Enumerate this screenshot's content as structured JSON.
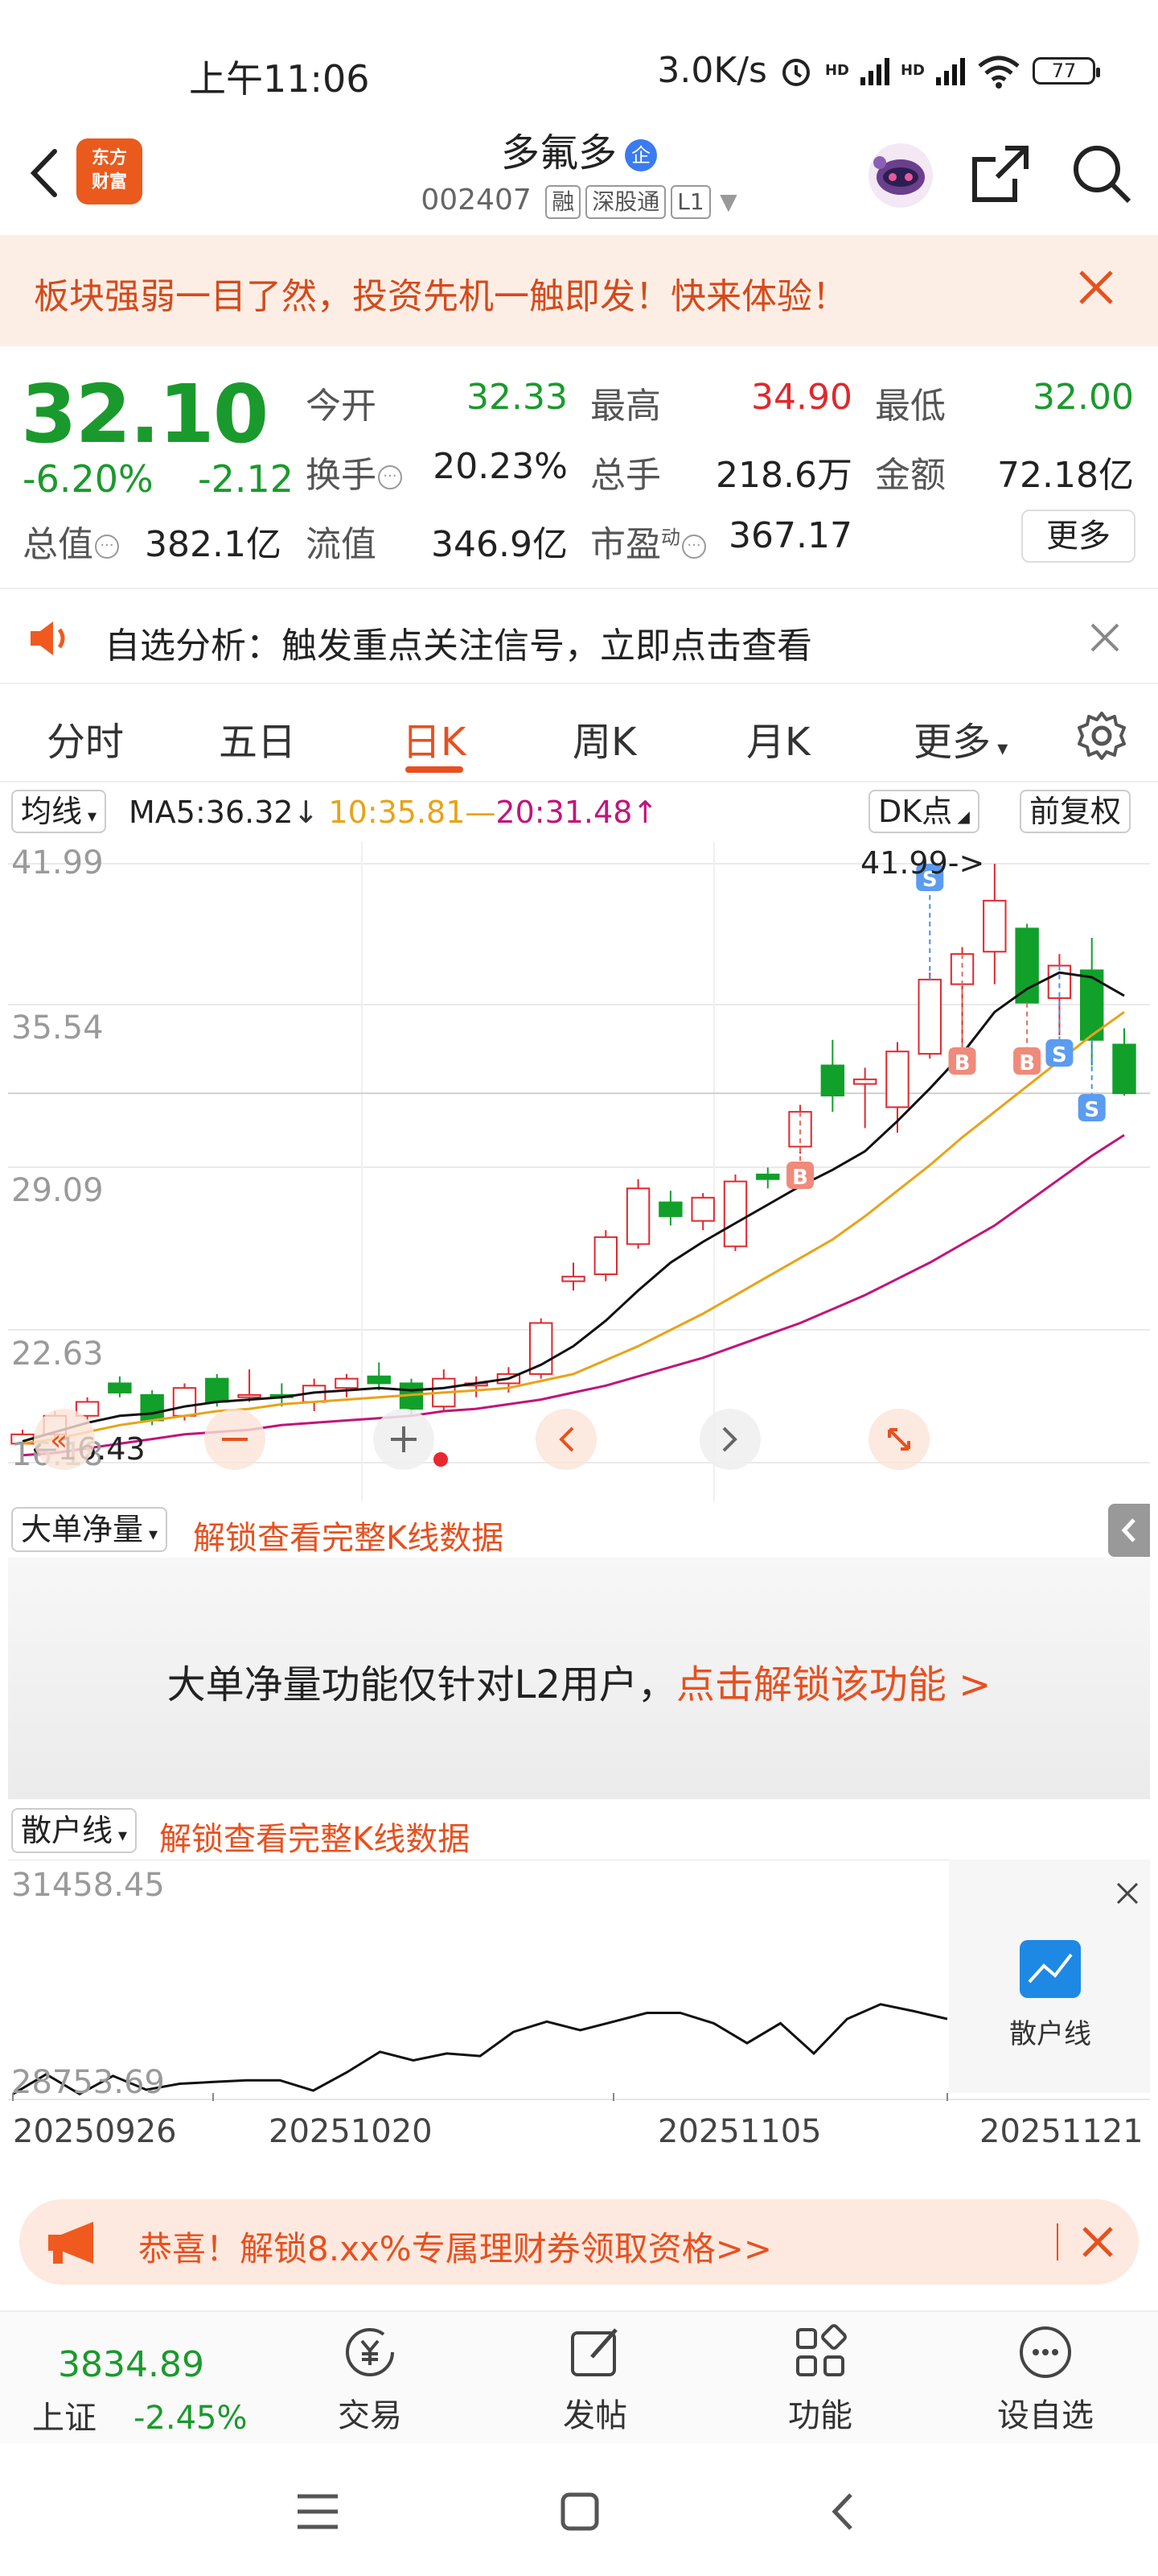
{
  "status": {
    "time": "上午11:06",
    "net_speed": "3.0K/s",
    "hd1": "HD",
    "hd2": "HD",
    "battery": "77"
  },
  "header": {
    "logo": "东方财富",
    "name": "多氟多",
    "corp_badge": "企",
    "code": "002407",
    "tags": [
      "融",
      "深股通",
      "L1"
    ]
  },
  "banner": {
    "text": "板块强弱一目了然，投资先机一触即发！快来体验！"
  },
  "quote": {
    "price": "32.10",
    "change_pct": "-6.20%",
    "change": "-2.12",
    "open_label": "今开",
    "open": "32.33",
    "high_label": "最高",
    "high": "34.90",
    "low_label": "最低",
    "low": "32.00",
    "turnover_label": "换手",
    "turnover": "20.23%",
    "volume_label": "总手",
    "volume": "218.6万",
    "amount_label": "金额",
    "amount": "72.18亿",
    "mcap_label": "总值",
    "mcap": "382.1亿",
    "float_label": "流值",
    "float": "346.9亿",
    "pe_label": "市盈",
    "pe_sup": "动",
    "pe": "367.17",
    "more": "更多"
  },
  "alert": {
    "text": "自选分析：触发重点关注信号，立即点击查看"
  },
  "tabs": [
    "分时",
    "五日",
    "日K",
    "周K",
    "月K",
    "更多"
  ],
  "indicators": {
    "ma_select": "均线",
    "ma5": "MA5:36.32",
    "ma10": "10:35.81",
    "ma20": "20:31.48",
    "dk": "DK点",
    "adjust": "前复权"
  },
  "chart_data": {
    "type": "candlestick",
    "y_ticks": [
      "41.99",
      "35.54",
      "29.09",
      "22.63",
      "16.18"
    ],
    "ylim": [
      16.18,
      41.99
    ],
    "high_annotation": "41.99->",
    "low_annotation": "16.43",
    "signals": [
      "S",
      "S",
      "B",
      "B",
      "S",
      "B"
    ],
    "candles": [
      {
        "o": 17.0,
        "h": 17.6,
        "l": 16.43,
        "c": 17.4
      },
      {
        "o": 17.4,
        "h": 18.4,
        "l": 17.2,
        "c": 18.2
      },
      {
        "o": 18.2,
        "h": 19.0,
        "l": 18.0,
        "c": 18.8
      },
      {
        "o": 19.6,
        "h": 19.9,
        "l": 19.0,
        "c": 19.2
      },
      {
        "o": 19.1,
        "h": 19.3,
        "l": 17.8,
        "c": 18.0
      },
      {
        "o": 18.2,
        "h": 19.6,
        "l": 18.0,
        "c": 19.4
      },
      {
        "o": 19.8,
        "h": 20.0,
        "l": 18.6,
        "c": 18.8
      },
      {
        "o": 19.0,
        "h": 20.2,
        "l": 18.8,
        "c": 19.1
      },
      {
        "o": 19.1,
        "h": 19.6,
        "l": 18.6,
        "c": 19.0
      },
      {
        "o": 18.8,
        "h": 19.8,
        "l": 18.4,
        "c": 19.5
      },
      {
        "o": 19.4,
        "h": 20.0,
        "l": 19.0,
        "c": 19.8
      },
      {
        "o": 19.9,
        "h": 20.5,
        "l": 19.3,
        "c": 19.6
      },
      {
        "o": 19.6,
        "h": 19.8,
        "l": 18.2,
        "c": 18.5
      },
      {
        "o": 18.6,
        "h": 20.2,
        "l": 18.4,
        "c": 19.8
      },
      {
        "o": 19.5,
        "h": 19.9,
        "l": 19.0,
        "c": 19.6
      },
      {
        "o": 19.6,
        "h": 20.3,
        "l": 19.2,
        "c": 20.0
      },
      {
        "o": 20.0,
        "h": 22.4,
        "l": 19.8,
        "c": 22.2
      },
      {
        "o": 24.0,
        "h": 24.8,
        "l": 23.6,
        "c": 24.2
      },
      {
        "o": 24.3,
        "h": 26.2,
        "l": 24.0,
        "c": 25.9
      },
      {
        "o": 25.6,
        "h": 28.4,
        "l": 25.4,
        "c": 28.0
      },
      {
        "o": 27.4,
        "h": 27.9,
        "l": 26.4,
        "c": 26.8
      },
      {
        "o": 26.6,
        "h": 27.8,
        "l": 26.2,
        "c": 27.6
      },
      {
        "o": 25.5,
        "h": 28.6,
        "l": 25.3,
        "c": 28.3
      },
      {
        "o": 28.6,
        "h": 28.9,
        "l": 28.0,
        "c": 28.4
      },
      {
        "o": 29.8,
        "h": 31.6,
        "l": 29.5,
        "c": 31.3
      },
      {
        "o": 33.3,
        "h": 34.4,
        "l": 31.3,
        "c": 32.0
      },
      {
        "o": 32.5,
        "h": 33.2,
        "l": 30.6,
        "c": 32.7
      },
      {
        "o": 31.5,
        "h": 34.3,
        "l": 30.4,
        "c": 33.9
      },
      {
        "o": 33.8,
        "h": 37.3,
        "l": 33.6,
        "c": 37.0
      },
      {
        "o": 36.8,
        "h": 38.4,
        "l": 33.5,
        "c": 38.1
      },
      {
        "o": 38.2,
        "h": 41.99,
        "l": 36.8,
        "c": 40.4
      },
      {
        "o": 39.2,
        "h": 39.4,
        "l": 35.9,
        "c": 36.0
      },
      {
        "o": 36.2,
        "h": 38.1,
        "l": 34.6,
        "c": 37.6
      },
      {
        "o": 37.4,
        "h": 38.8,
        "l": 33.3,
        "c": 34.4
      },
      {
        "o": 34.2,
        "h": 34.9,
        "l": 32.0,
        "c": 32.1
      }
    ],
    "ma5": [
      17.1,
      17.5,
      17.9,
      18.2,
      18.3,
      18.6,
      18.8,
      18.9,
      19.0,
      19.2,
      19.3,
      19.4,
      19.3,
      19.4,
      19.6,
      19.8,
      20.4,
      21.2,
      22.3,
      23.6,
      24.8,
      25.7,
      26.5,
      27.3,
      28.1,
      28.8,
      29.6,
      30.9,
      32.3,
      33.8,
      35.6,
      36.6,
      37.3,
      37.1,
      36.3
    ],
    "ma10": [
      17.0,
      17.2,
      17.5,
      17.8,
      18.0,
      18.2,
      18.4,
      18.5,
      18.7,
      18.8,
      18.9,
      19.0,
      19.1,
      19.2,
      19.3,
      19.4,
      19.7,
      20.0,
      20.6,
      21.2,
      21.9,
      22.6,
      23.4,
      24.2,
      25.0,
      25.8,
      26.8,
      27.9,
      29.0,
      30.2,
      31.3,
      32.4,
      33.5,
      34.6,
      35.6
    ],
    "ma20": [
      16.5,
      16.6,
      16.8,
      17.0,
      17.2,
      17.4,
      17.5,
      17.6,
      17.8,
      17.9,
      18.0,
      18.1,
      18.2,
      18.4,
      18.5,
      18.7,
      18.9,
      19.2,
      19.5,
      19.9,
      20.3,
      20.7,
      21.2,
      21.7,
      22.2,
      22.8,
      23.4,
      24.1,
      24.8,
      25.6,
      26.4,
      27.4,
      28.4,
      29.4,
      30.3
    ]
  },
  "sections": {
    "big_order": {
      "select": "大单净量",
      "unlock": "解锁查看完整K线数据",
      "msg": "大单净量功能仅针对L2用户，",
      "msg_link": "点击解锁该功能 >"
    },
    "retail": {
      "select": "散户线",
      "unlock": "解锁查看完整K线数据",
      "max": "31458.45",
      "min": "28753.69",
      "badge": "散户线"
    }
  },
  "retail_chart_data": {
    "type": "line",
    "ylim": [
      28753.69,
      31458.45
    ],
    "values": [
      28760,
      28990,
      28760,
      28970,
      28810,
      28880,
      28900,
      28920,
      28920,
      28800,
      29010,
      29250,
      29150,
      29230,
      29200,
      29480,
      29600,
      29500,
      29600,
      29700,
      29700,
      29580,
      29350,
      29580,
      29230,
      29630,
      29800,
      29720,
      29630
    ]
  },
  "dates": [
    "20250926",
    "20251020",
    "20251105",
    "20251121"
  ],
  "promo": {
    "text": "恭喜！解锁8.xx%专属理财券领取资格>>"
  },
  "bottom": {
    "index_value": "3834.89",
    "index_name": "上证",
    "index_change": "-2.45%",
    "items": [
      "交易",
      "发帖",
      "功能",
      "设自选"
    ]
  }
}
